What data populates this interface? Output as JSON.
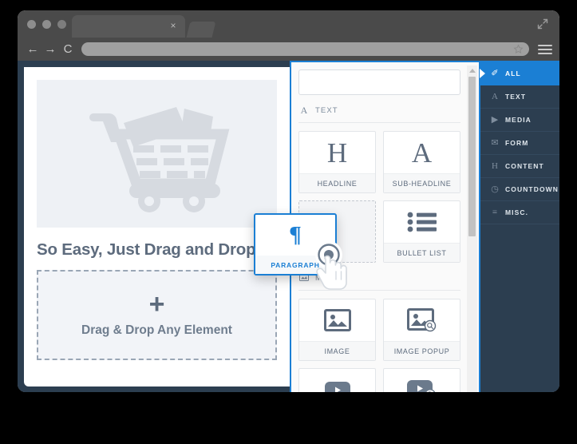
{
  "browser": {
    "tab_close_label": "×",
    "nav": {
      "back": "←",
      "forward": "→",
      "reload": "C"
    },
    "url_value": "",
    "url_placeholder": "",
    "icons": {
      "expand": "expand-icon",
      "star": "bookmark-star-icon",
      "menu": "hamburger-menu-icon"
    }
  },
  "canvas": {
    "hero_icon": "shopping-cart-icon",
    "headline": "So Easy, Just Drag and Drop",
    "dropzone": {
      "plus": "+",
      "label": "Drag & Drop Any Element"
    }
  },
  "panel": {
    "search": {
      "value": "",
      "placeholder": ""
    },
    "groups": [
      {
        "icon": "A",
        "icon_name": "text-group-icon",
        "label": "TEXT",
        "tiles": [
          {
            "glyph": "H",
            "label": "HEADLINE",
            "icon_name": "headline-icon",
            "kind": "serif"
          },
          {
            "glyph": "A",
            "label": "SUB-HEADLINE",
            "icon_name": "sub-headline-icon",
            "kind": "serif"
          },
          {
            "glyph": "",
            "label": "",
            "icon_name": "paragraph-placeholder",
            "kind": "placeholder"
          },
          {
            "glyph": "",
            "label": "BULLET LIST",
            "icon_name": "bullet-list-icon",
            "kind": "bullet"
          }
        ]
      },
      {
        "icon": "",
        "icon_name": "media-group-icon",
        "label": "MEDIA",
        "tiles": [
          {
            "glyph": "",
            "label": "IMAGE",
            "icon_name": "image-icon",
            "kind": "image"
          },
          {
            "glyph": "",
            "label": "IMAGE POPUP",
            "icon_name": "image-popup-icon",
            "kind": "image-zoom"
          },
          {
            "glyph": "",
            "label": "",
            "icon_name": "video-icon",
            "kind": "video"
          },
          {
            "glyph": "",
            "label": "",
            "icon_name": "video-popup-icon",
            "kind": "video-zoom"
          }
        ]
      }
    ]
  },
  "sidebar": {
    "items": [
      {
        "label": "ALL",
        "icon": "✐",
        "icon_name": "all-icon",
        "active": true
      },
      {
        "label": "TEXT",
        "icon": "A",
        "icon_name": "text-icon",
        "active": false
      },
      {
        "label": "MEDIA",
        "icon": "▶",
        "icon_name": "play-icon",
        "active": false
      },
      {
        "label": "FORM",
        "icon": "✉",
        "icon_name": "envelope-icon",
        "active": false
      },
      {
        "label": "CONTENT",
        "icon": "H",
        "icon_name": "content-icon",
        "active": false
      },
      {
        "label": "COUNTDOWN",
        "icon": "◷",
        "icon_name": "clock-icon",
        "active": false
      },
      {
        "label": "MISC.",
        "icon": "≡",
        "icon_name": "misc-icon",
        "active": false
      }
    ]
  },
  "drag": {
    "label": "PARAGRAPH",
    "glyph": "¶",
    "icon_name": "paragraph-icon",
    "cursor_name": "hand-pointer-cursor"
  },
  "colors": {
    "accent": "#1b7fd4",
    "dark_navy": "#2c3e50",
    "chrome_gray": "#4a4a4a",
    "muted_text": "#5d6b7d"
  }
}
